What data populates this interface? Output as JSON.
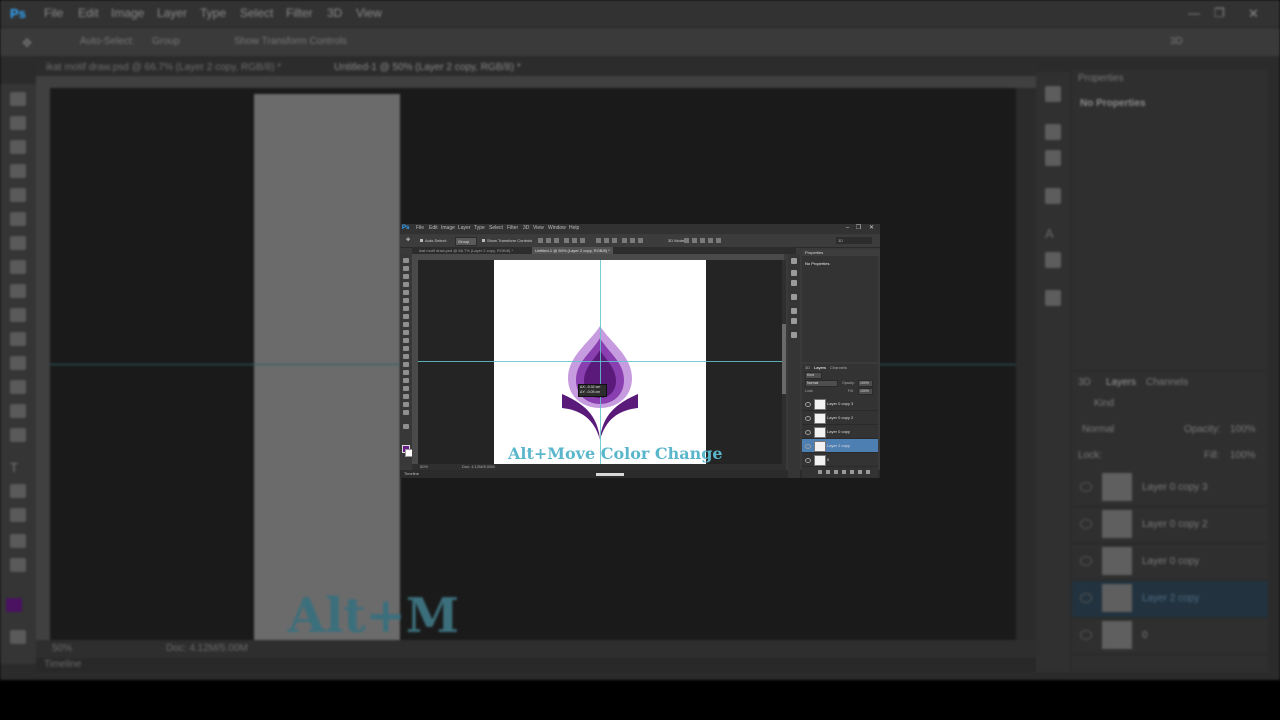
{
  "app": {
    "logo": "Ps",
    "menu": [
      "File",
      "Edit",
      "Image",
      "Layer",
      "Type",
      "Select",
      "Filter",
      "3D",
      "View",
      "Window",
      "Help"
    ]
  },
  "options_bar": {
    "auto_select_label": "Auto-Select:",
    "auto_select_value": "Group",
    "show_transform_label": "Show Transform Controls",
    "mode_label": "3D Mode:",
    "workspace": "3D"
  },
  "tabs": [
    {
      "label": "ikat motif draw.psd @ 66.7% (Layer 2 copy, RGB/8) *",
      "active": false
    },
    {
      "label": "Untitled-1 @ 50% (Layer 2 copy, RGB/8) *",
      "active": true
    }
  ],
  "canvas": {
    "caption": "Alt+Move Color Change",
    "caption_color": "#5ab7cb",
    "measure_line1": "ΔX: -0.02 cm",
    "measure_line2": "ΔY: -0.05 cm"
  },
  "colors": {
    "foreground": "#6a1e88",
    "background": "#ffffff",
    "guide": "#5fc6d0",
    "motif_dark": "#5a1a7a",
    "motif_mid": "#8a3fb0",
    "motif_light": "#c79be0"
  },
  "status": {
    "zoom": "50%",
    "doc": "Doc: 4.12M/5.00M"
  },
  "timeline_label": "Timeline",
  "properties": {
    "title": "Properties",
    "empty": "No Properties"
  },
  "layers_panel": {
    "tabs": [
      "3D",
      "Layers",
      "Channels"
    ],
    "kind": "Kind",
    "blend_mode": "Normal",
    "opacity_label": "Opacity:",
    "opacity_value": "100%",
    "lock_label": "Lock:",
    "fill_label": "Fill:",
    "fill_value": "100%",
    "layers": [
      {
        "name": "Layer 0 copy 3",
        "selected": false
      },
      {
        "name": "Layer 0 copy 2",
        "selected": false
      },
      {
        "name": "Layer 0 copy",
        "selected": false
      },
      {
        "name": "Layer 2 copy",
        "selected": true
      },
      {
        "name": "0",
        "selected": false
      }
    ]
  }
}
